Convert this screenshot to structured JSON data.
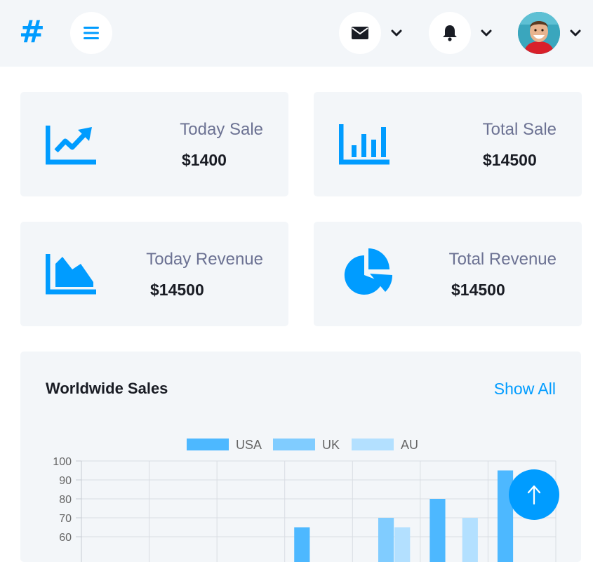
{
  "brand": {
    "logo_text": "#"
  },
  "topbar": {
    "menu_icon": "bars-icon",
    "messages_icon": "envelope-icon",
    "notifications_icon": "bell-icon",
    "dropdown_icon": "chevron-down-icon",
    "avatar_icon": "user-avatar"
  },
  "stats": [
    {
      "label": "Today Sale",
      "value": "$1400",
      "icon": "chart-line-icon"
    },
    {
      "label": "Total Sale",
      "value": "$14500",
      "icon": "chart-bar-icon"
    },
    {
      "label": "Today Revenue",
      "value": "$14500",
      "icon": "chart-area-icon"
    },
    {
      "label": "Total Revenue",
      "value": "$14500",
      "icon": "chart-pie-icon"
    }
  ],
  "sales": {
    "title": "Worldwide Sales",
    "show_all": "Show All"
  },
  "colors": {
    "accent": "#009cff",
    "panel": "#f3f6f9",
    "text_dark": "#191c24",
    "text_muted": "#6c7293"
  },
  "chart_data": {
    "type": "bar",
    "categories": [
      "",
      "",
      "",
      "",
      "",
      "",
      ""
    ],
    "series": [
      {
        "name": "USA",
        "color": "#4db8ff",
        "values": [
          null,
          null,
          null,
          65,
          null,
          80,
          95
        ]
      },
      {
        "name": "UK",
        "color": "#80ccff",
        "values": [
          null,
          null,
          null,
          null,
          70,
          null,
          null
        ]
      },
      {
        "name": "AU",
        "color": "#b3e0ff",
        "values": [
          null,
          null,
          null,
          null,
          65,
          70,
          null
        ]
      }
    ],
    "yticks": [
      "100",
      "90",
      "80",
      "70",
      "60"
    ],
    "ylim": [
      60,
      100
    ],
    "legend": "top-center",
    "grid": true
  },
  "scroll_top": {
    "icon": "arrow-up-icon"
  }
}
